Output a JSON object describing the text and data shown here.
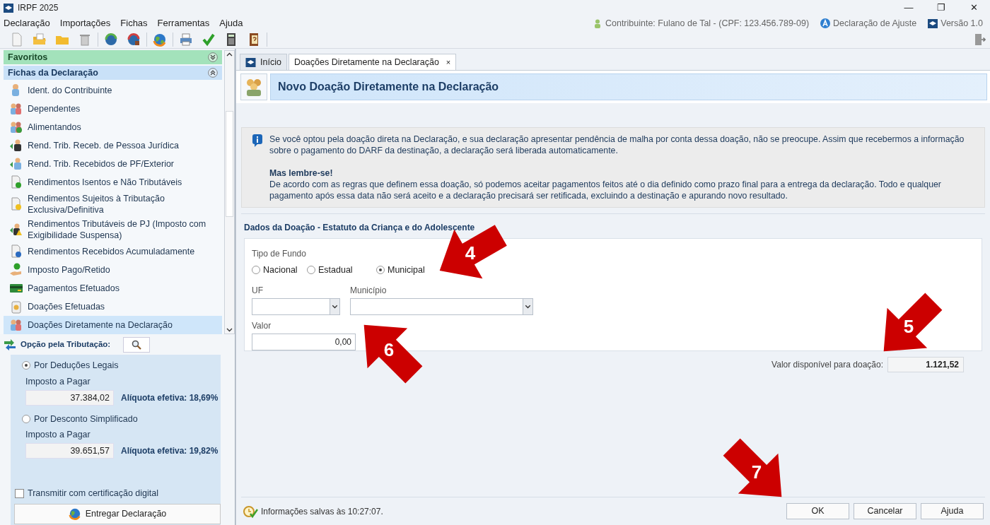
{
  "window": {
    "title": "IRPF 2025",
    "controls": [
      "—",
      "❐",
      "✕"
    ]
  },
  "menu": [
    "Declaração",
    "Importações",
    "Fichas",
    "Ferramentas",
    "Ajuda"
  ],
  "header_info": {
    "contributor": "Contribuinte: Fulano de Tal - (CPF: 123.456.789-09)",
    "declaration_type": "Declaração de Ajuste",
    "version": "Versão 1.0"
  },
  "sidebar": {
    "sections": [
      {
        "label": "Favoritos",
        "expanded": false
      },
      {
        "label": "Fichas da Declaração",
        "expanded": true
      }
    ],
    "items": [
      {
        "label": "Ident. do Contribuinte",
        "selected": false
      },
      {
        "label": "Dependentes",
        "selected": false
      },
      {
        "label": "Alimentandos",
        "selected": false
      },
      {
        "label": "Rend. Trib. Receb. de Pessoa Jurídica",
        "selected": false
      },
      {
        "label": "Rend. Trib. Recebidos de PF/Exterior",
        "selected": false
      },
      {
        "label": "Rendimentos Isentos e Não Tributáveis",
        "selected": false
      },
      {
        "label": "Rendimentos Sujeitos à Tributação Exclusiva/Definitiva",
        "selected": false
      },
      {
        "label": "Rendimentos Tributáveis de PJ (Imposto com Exigibilidade Suspensa)",
        "selected": false
      },
      {
        "label": "Rendimentos Recebidos Acumuladamente",
        "selected": false
      },
      {
        "label": "Imposto Pago/Retido",
        "selected": false
      },
      {
        "label": "Pagamentos Efetuados",
        "selected": false
      },
      {
        "label": "Doações Efetuadas",
        "selected": false
      },
      {
        "label": "Doações Diretamente na Declaração",
        "selected": true
      }
    ]
  },
  "tax_option": {
    "title": "Opção pela Tributação:",
    "options": [
      {
        "label": "Por Deduções Legais",
        "selected": true,
        "tax_label": "Imposto a Pagar",
        "tax_value": "37.384,02",
        "rate": "Alíquota efetiva: 18,69%"
      },
      {
        "label": "Por Desconto Simplificado",
        "selected": false,
        "tax_label": "Imposto a Pagar",
        "tax_value": "39.651,57",
        "rate": "Alíquota efetiva: 19,82%"
      }
    ],
    "certificate": {
      "label": "Transmitir com certificação digital",
      "checked": false
    },
    "submit_button": "Entregar Declaração"
  },
  "tabs": [
    {
      "label": "Início",
      "selected": false
    },
    {
      "label": "Doações Diretamente na Declaração",
      "selected": true,
      "close": "×"
    }
  ],
  "form": {
    "title": "Novo Doação Diretamente na Declaração",
    "info": {
      "paragraph": "Se você optou pela doação direta na Declaração, e sua declaração apresentar pendência de malha por conta dessa doação, não se preocupe. Assim que recebermos a informação sobre o pagamento do DARF da destinação, a declaração será liberada automaticamente.",
      "heading": "Mas lembre-se!",
      "paragraph_2": "De acordo com as regras que definem essa doação, só podemos aceitar pagamentos feitos até o dia definido como prazo final para a entrega da declaração. Todo e qualquer pagamento após essa data não será aceito e a declaração precisará ser retificada, excluindo a destinação e apurando novo resultado."
    },
    "section_title": "Dados da Doação - Estatuto da Criança e do Adolescente",
    "fund_type": {
      "label": "Tipo de Fundo",
      "options": [
        {
          "label": "Nacional",
          "selected": false
        },
        {
          "label": "Estadual",
          "selected": false
        },
        {
          "label": "Municipal",
          "selected": true
        }
      ]
    },
    "uf_label": "UF",
    "municipio_label": "Município",
    "valor_label": "Valor",
    "valor": "0,00",
    "available_label": "Valor disponível para doação:",
    "available_value": "1.121,52"
  },
  "status": "Informações salvas às 10:27:07.",
  "buttons": [
    "OK",
    "Cancelar",
    "Ajuda"
  ],
  "annotations": [
    {
      "number": "4"
    },
    {
      "number": "5"
    },
    {
      "number": "6"
    },
    {
      "number": "7"
    }
  ]
}
